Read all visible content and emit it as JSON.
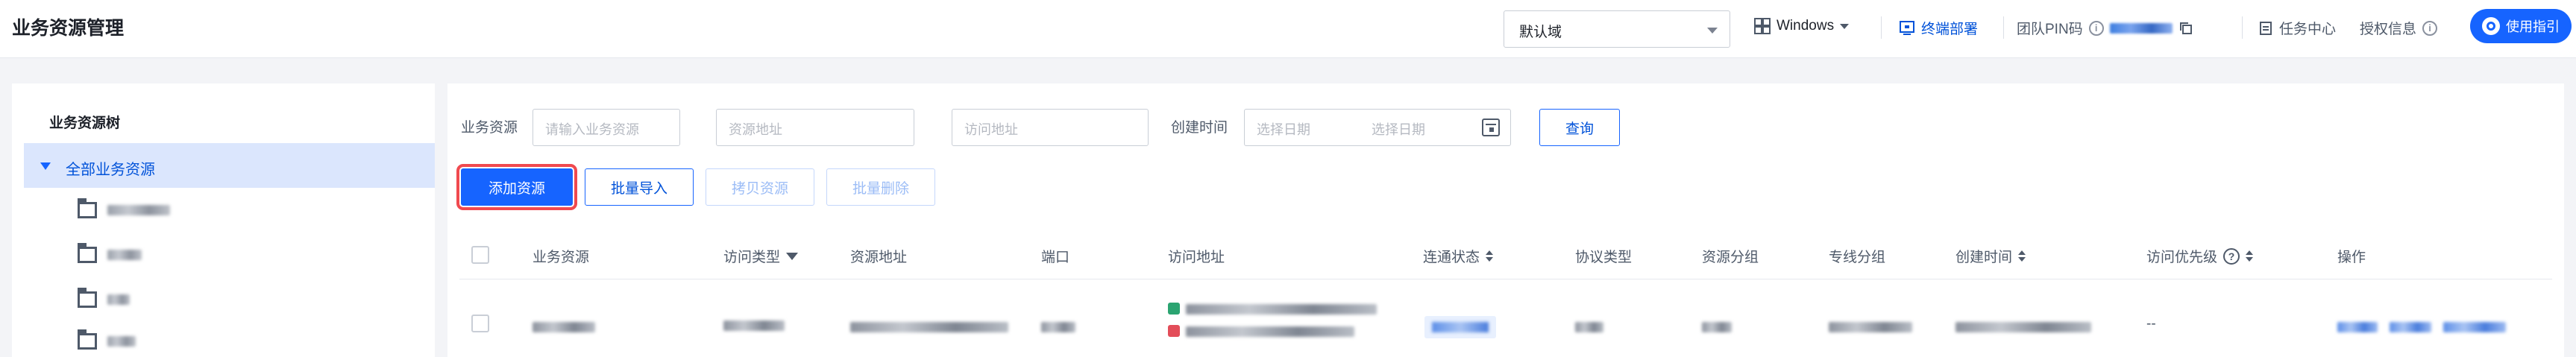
{
  "header": {
    "title": "业务资源管理",
    "domain_select": "默认域",
    "os": "Windows",
    "terminal_deploy": "终端部署",
    "team_pin_label": "团队PIN码",
    "task_center": "任务中心",
    "license_info": "授权信息",
    "guide": "使用指引"
  },
  "tree": {
    "title": "业务资源树",
    "root": "全部业务资源"
  },
  "filters": {
    "biz_label": "业务资源",
    "biz_placeholder": "请输入业务资源",
    "res_addr_placeholder": "资源地址",
    "access_addr_placeholder": "访问地址",
    "created_label": "创建时间",
    "start_placeholder": "选择日期",
    "end_placeholder": "选择日期",
    "query": "查询"
  },
  "actions": {
    "add": "添加资源",
    "import": "批量导入",
    "copy": "拷贝资源",
    "delete": "批量删除"
  },
  "table": {
    "columns": [
      "业务资源",
      "访问类型",
      "资源地址",
      "端口",
      "访问地址",
      "连通状态",
      "协议类型",
      "资源分组",
      "专线分组",
      "创建时间",
      "访问优先级",
      "操作"
    ],
    "priority_value": "--"
  },
  "colors": {
    "primary": "#1664ff",
    "highlight_border": "#f0494f",
    "tree_selected_bg": "#dbe6fd"
  }
}
